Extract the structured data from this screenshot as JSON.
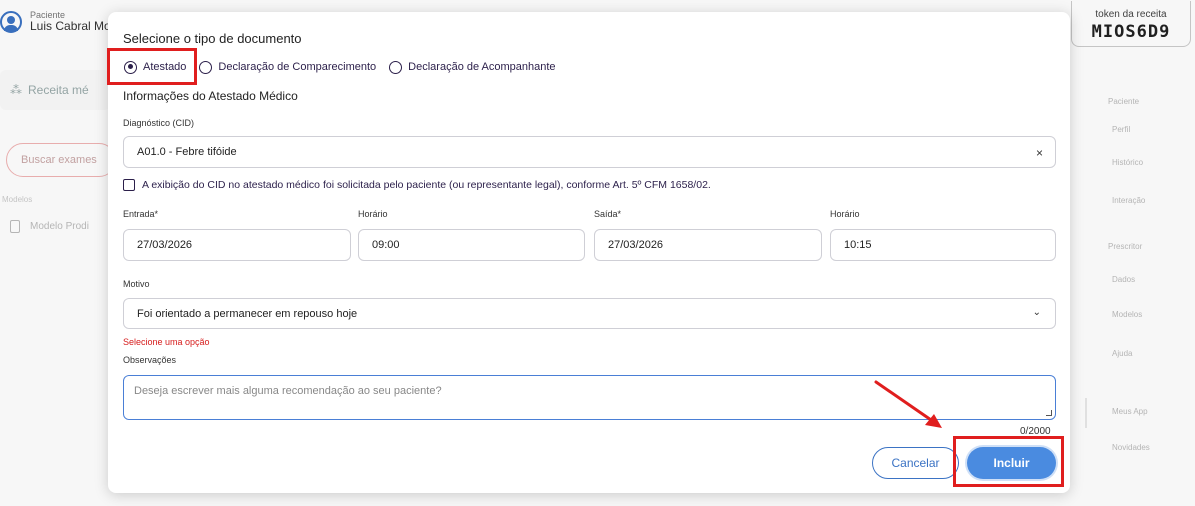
{
  "background": {
    "patient_label": "Paciente",
    "patient_name": "Luis Cabral Mo",
    "left_card": "Receita mé",
    "left_search": "Buscar exames",
    "left_small": "Modelos",
    "left_model": "Modelo Prodi",
    "token_label": "token da receita",
    "token_value": "MIOS6D9",
    "right_menu": [
      "Paciente",
      "Perfil",
      "Histórico",
      "Interação",
      "Prescritor",
      "Dados",
      "Modelos",
      "Ajuda",
      "Meus App",
      "Novidades"
    ]
  },
  "modal": {
    "title": "Selecione o tipo de documento",
    "types": [
      {
        "label": "Atestado",
        "selected": true
      },
      {
        "label": "Declaração de Comparecimento",
        "selected": false
      },
      {
        "label": "Declaração de Acompanhante",
        "selected": false
      }
    ],
    "section_title": "Informações do Atestado Médico",
    "diagnostico_label": "Diagnóstico (CID)",
    "diagnostico_value": "A01.0 - Febre tifóide",
    "clear_icon": "×",
    "cid_checkbox_label": "A exibição do CID no atestado médico foi solicitada pelo paciente (ou representante legal), conforme Art. 5º CFM 1658/02.",
    "entrada_label": "Entrada*",
    "entrada_value": "27/03/2026",
    "horario1_label": "Horário",
    "horario1_value": "09:00",
    "saida_label": "Saída*",
    "saida_value": "27/03/2026",
    "horario2_label": "Horário",
    "horario2_value": "10:15",
    "motivo_label": "Motivo",
    "motivo_value": "Foi orientado a permanecer em repouso hoje",
    "motivo_error": "Selecione uma opção",
    "observacoes_label": "Observações",
    "observacoes_placeholder": "Deseja escrever mais alguma recomendação ao seu paciente?",
    "counter": "0/2000",
    "cancel_label": "Cancelar",
    "include_label": "Incluir"
  },
  "colors": {
    "accent": "#4a8be0",
    "highlight": "#e01e1e",
    "radio": "#2b1f4a",
    "error": "#d61c1c"
  }
}
